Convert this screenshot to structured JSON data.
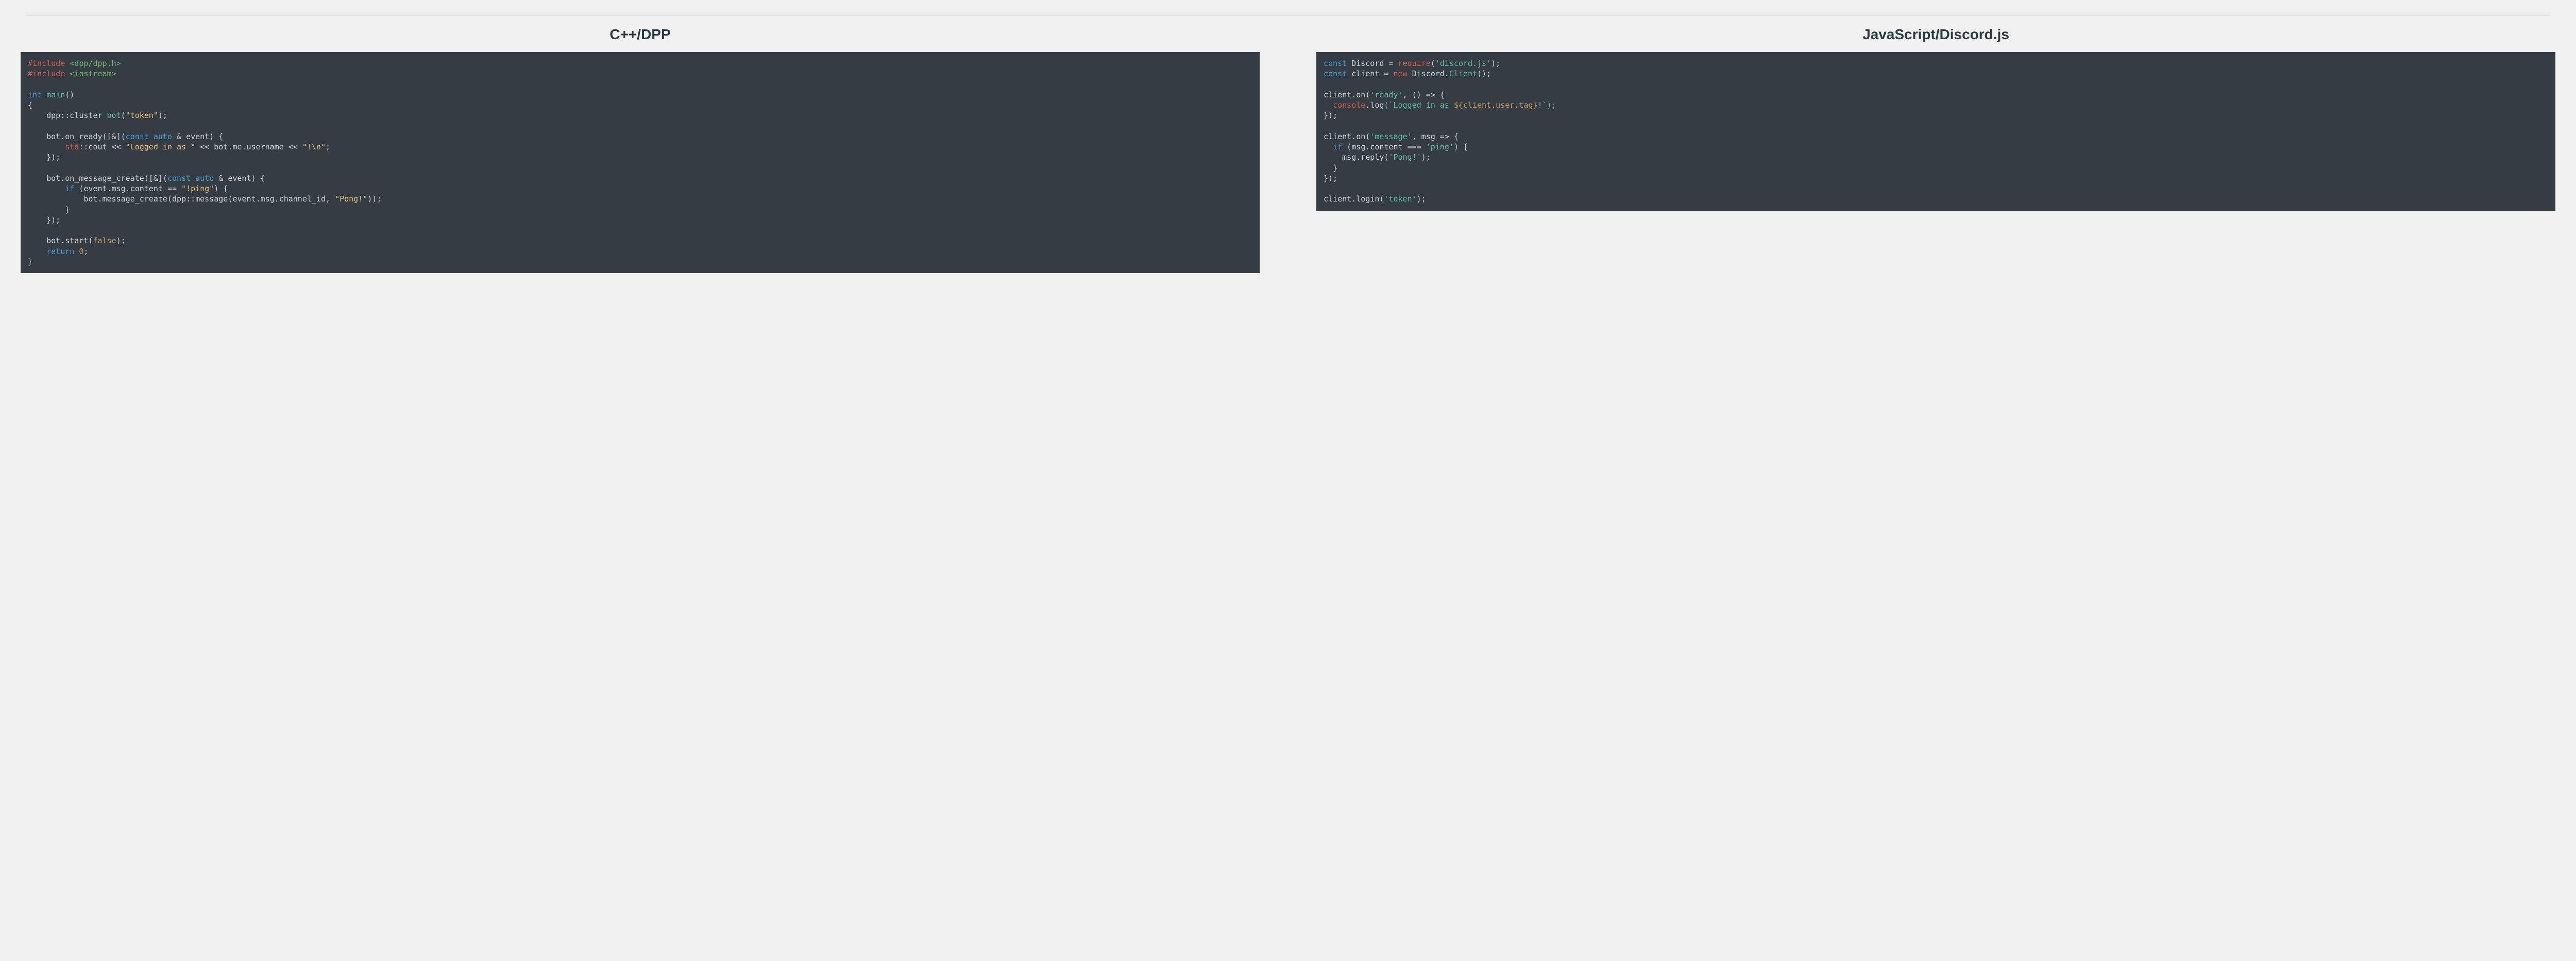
{
  "left": {
    "title": "C++/DPP",
    "code": {
      "include1_macro": "#include",
      "include1_path": "<dpp/dpp.h>",
      "include2_macro": "#include",
      "include2_path": "<iostream>",
      "kw_int": "int",
      "fn_main": "main",
      "main_parens": "()",
      "brace_open": "{",
      "indent": "    ",
      "ns_dpp": "dpp",
      "coloncolon": "::",
      "cluster": "cluster ",
      "bot_decl": "bot",
      "paren_open": "(",
      "str_token": "\"token\"",
      "paren_close_semi": ");",
      "bot_dot": "bot.",
      "on_ready": "on_ready",
      "lambda_open": "([&](",
      "kw_const": "const",
      "kw_auto": " auto ",
      "amp": "& ",
      "event": "event",
      "paren_brace": ") {",
      "ns_std": "std",
      "cout": "cout ",
      "lshift": "<< ",
      "str_logged": "\"Logged in as \"",
      "mid_lshift": " << ",
      "bot_me_user": "bot.me.username",
      "str_excl": "\"!\\n\"",
      "semi": ";",
      "close_lambda": "});",
      "on_msg": "on_message_create",
      "kw_if": "if",
      "if_open": " (",
      "event_msg_content": "event.msg.content ",
      "eqeq": "== ",
      "str_ping": "\"!ping\"",
      "if_close": ") {",
      "msg_create": "message_create",
      "dpp_msg": "message",
      "chan_id": "event.msg.channel_id",
      "comma_sp": ", ",
      "str_pong": "\"Pong!\"",
      "dbl_close": "));",
      "brace_close": "}",
      "start": "start",
      "kw_false": "false",
      "kw_return": "return",
      "zero": " 0",
      "final_brace": "}"
    }
  },
  "right": {
    "title": "JavaScript/Discord.js",
    "code": {
      "kw_const": "const",
      "discord": " Discord ",
      "eq": "= ",
      "require": "require",
      "paren_open": "(",
      "str_djs": "'discord.js'",
      "paren_close_semi": ");",
      "client": " client ",
      "kw_new": "new",
      "discord_client": " Discord.",
      "Client": "Client",
      "empty_parens_semi": "();",
      "client_on": "client.",
      "on": "on",
      "str_ready": "'ready'",
      "comma": ", ",
      "arrow_noarg": "() => {",
      "indent2": "  ",
      "console": "console",
      "dot_log": ".",
      "log": "log",
      "tpl_open": "(`",
      "tpl_logged": "Logged in as ",
      "tpl_interp_open": "${",
      "client_user_tag": "client.user.tag",
      "tpl_interp_close": "}",
      "tpl_excl": "!",
      "tpl_close": "`);",
      "close_cb": "});",
      "str_message": "'message'",
      "msg_arrow": "msg => {",
      "kw_if": "if",
      "if_open": " (",
      "msg_content": "msg.content ",
      "tripleeq": "=== ",
      "str_ping": "'ping'",
      "if_close": ") {",
      "indent4": "    ",
      "msg_reply": "msg.",
      "reply": "reply",
      "str_pong": "'Pong!'",
      "brace_close": "}",
      "login": "login",
      "str_token": "'token'"
    }
  }
}
